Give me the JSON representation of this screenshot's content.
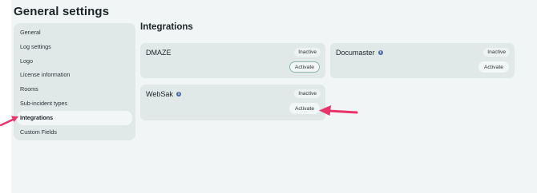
{
  "page_title": "General settings",
  "sidebar": {
    "items": [
      {
        "label": "General"
      },
      {
        "label": "Log settings"
      },
      {
        "label": "Logo"
      },
      {
        "label": "License information"
      },
      {
        "label": "Rooms"
      },
      {
        "label": "Sub-incident types"
      },
      {
        "label": "Integrations",
        "active": true
      },
      {
        "label": "Custom Fields"
      }
    ]
  },
  "integrations": {
    "title": "Integrations",
    "cards": [
      {
        "name": "DMAZE",
        "status": "Inactive",
        "action": "Activate",
        "info_icon": false
      },
      {
        "name": "Documaster",
        "status": "Inactive",
        "action": "Activate",
        "info_icon": true
      },
      {
        "name": "WebSak",
        "status": "Inactive",
        "action": "Activate",
        "info_icon": true
      }
    ]
  },
  "colors": {
    "annotation_arrow": "#e8336b"
  }
}
